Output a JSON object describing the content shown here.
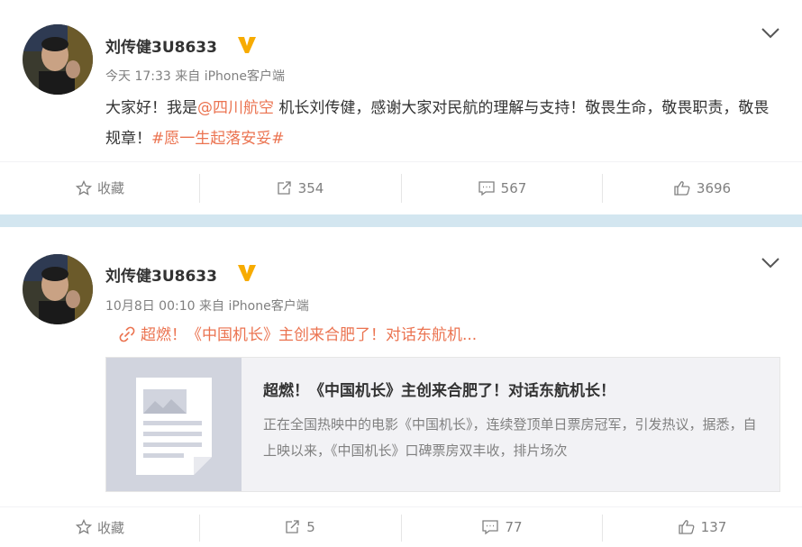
{
  "posts": [
    {
      "username": "刘传健3U8633",
      "verified_icon": "verified-v-icon",
      "time": "今天 17:33",
      "source_prefix": "来自",
      "source": "iPhone客户端",
      "text_parts": {
        "p1": "大家好！我是",
        "mention": "@四川航空",
        "p2": " 机长刘传健，感谢大家对民航的理解与支持！敬畏生命，敬畏职责，敬畏规章！",
        "hashtag": "#愿一生起落安妥#"
      },
      "actions": {
        "favorite": "收藏",
        "repost": "354",
        "comment": "567",
        "like": "3696"
      }
    },
    {
      "username": "刘传健3U8633",
      "verified_icon": "verified-v-icon",
      "time": "10月8日 00:10",
      "source_prefix": "来自",
      "source": "iPhone客户端",
      "link_text": "超燃！《中国机长》主创来合肥了！对话东航机...",
      "card": {
        "title": "超燃！《中国机长》主创来合肥了！对话东航机长！",
        "description": "正在全国热映中的电影《中国机长》，连续登顶单日票房冠军，引发热议，据悉，自上映以来，《中国机长》口碑票房双丰收，排片场次"
      },
      "actions": {
        "favorite": "收藏",
        "repost": "5",
        "comment": "77",
        "like": "137"
      }
    }
  ],
  "colors": {
    "link": "#eb7350",
    "meta": "#808080",
    "text": "#333333",
    "verified": "#f7ab00",
    "divider": "#d3e6f0"
  }
}
